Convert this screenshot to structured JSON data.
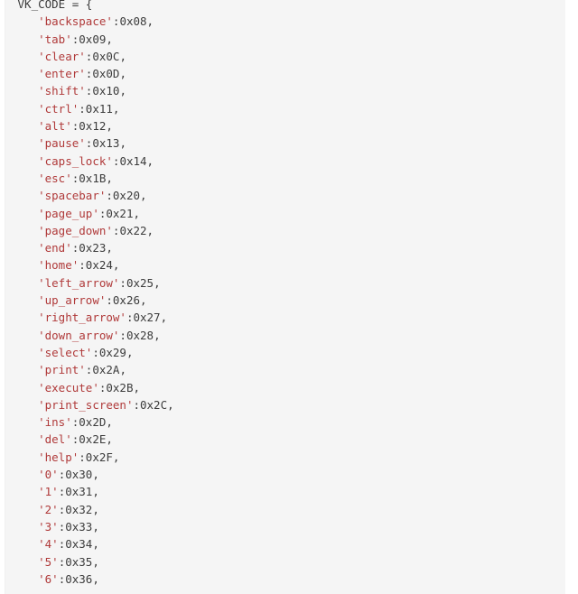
{
  "code_block": {
    "language": "python",
    "background_color": "#f5f5f5",
    "text_color": "#3c3c3c",
    "string_color": "#b03a3a",
    "first_line": {
      "name": "VK_CODE",
      "operator": " = ",
      "brace": "{"
    },
    "entries": [
      {
        "key": "'backspace'",
        "sep": ":",
        "value": "0x08",
        "comma": ","
      },
      {
        "key": "'tab'",
        "sep": ":",
        "value": "0x09",
        "comma": ","
      },
      {
        "key": "'clear'",
        "sep": ":",
        "value": "0x0C",
        "comma": ","
      },
      {
        "key": "'enter'",
        "sep": ":",
        "value": "0x0D",
        "comma": ","
      },
      {
        "key": "'shift'",
        "sep": ":",
        "value": "0x10",
        "comma": ","
      },
      {
        "key": "'ctrl'",
        "sep": ":",
        "value": "0x11",
        "comma": ","
      },
      {
        "key": "'alt'",
        "sep": ":",
        "value": "0x12",
        "comma": ","
      },
      {
        "key": "'pause'",
        "sep": ":",
        "value": "0x13",
        "comma": ","
      },
      {
        "key": "'caps_lock'",
        "sep": ":",
        "value": "0x14",
        "comma": ","
      },
      {
        "key": "'esc'",
        "sep": ":",
        "value": "0x1B",
        "comma": ","
      },
      {
        "key": "'spacebar'",
        "sep": ":",
        "value": "0x20",
        "comma": ","
      },
      {
        "key": "'page_up'",
        "sep": ":",
        "value": "0x21",
        "comma": ","
      },
      {
        "key": "'page_down'",
        "sep": ":",
        "value": "0x22",
        "comma": ","
      },
      {
        "key": "'end'",
        "sep": ":",
        "value": "0x23",
        "comma": ","
      },
      {
        "key": "'home'",
        "sep": ":",
        "value": "0x24",
        "comma": ","
      },
      {
        "key": "'left_arrow'",
        "sep": ":",
        "value": "0x25",
        "comma": ","
      },
      {
        "key": "'up_arrow'",
        "sep": ":",
        "value": "0x26",
        "comma": ","
      },
      {
        "key": "'right_arrow'",
        "sep": ":",
        "value": "0x27",
        "comma": ","
      },
      {
        "key": "'down_arrow'",
        "sep": ":",
        "value": "0x28",
        "comma": ","
      },
      {
        "key": "'select'",
        "sep": ":",
        "value": "0x29",
        "comma": ","
      },
      {
        "key": "'print'",
        "sep": ":",
        "value": "0x2A",
        "comma": ","
      },
      {
        "key": "'execute'",
        "sep": ":",
        "value": "0x2B",
        "comma": ","
      },
      {
        "key": "'print_screen'",
        "sep": ":",
        "value": "0x2C",
        "comma": ","
      },
      {
        "key": "'ins'",
        "sep": ":",
        "value": "0x2D",
        "comma": ","
      },
      {
        "key": "'del'",
        "sep": ":",
        "value": "0x2E",
        "comma": ","
      },
      {
        "key": "'help'",
        "sep": ":",
        "value": "0x2F",
        "comma": ","
      },
      {
        "key": "'0'",
        "sep": ":",
        "value": "0x30",
        "comma": ","
      },
      {
        "key": "'1'",
        "sep": ":",
        "value": "0x31",
        "comma": ","
      },
      {
        "key": "'2'",
        "sep": ":",
        "value": "0x32",
        "comma": ","
      },
      {
        "key": "'3'",
        "sep": ":",
        "value": "0x33",
        "comma": ","
      },
      {
        "key": "'4'",
        "sep": ":",
        "value": "0x34",
        "comma": ","
      },
      {
        "key": "'5'",
        "sep": ":",
        "value": "0x35",
        "comma": ","
      },
      {
        "key": "'6'",
        "sep": ":",
        "value": "0x36",
        "comma": ","
      }
    ],
    "indent": "    "
  }
}
